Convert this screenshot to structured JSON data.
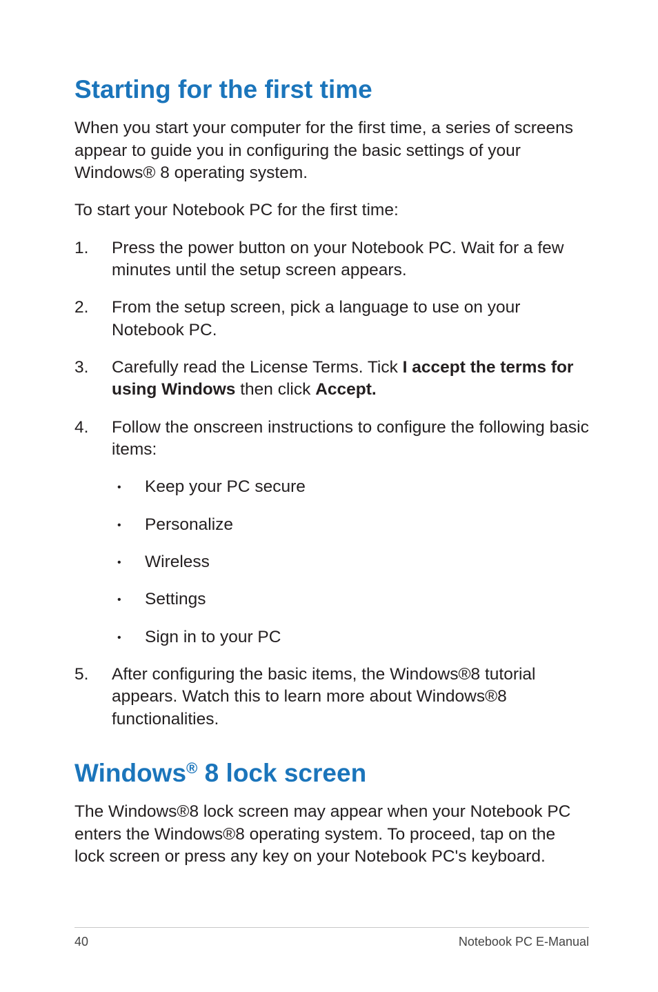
{
  "section1": {
    "heading": "Starting for the first time",
    "intro": "When you start your computer for the first time, a series of screens appear to guide you in configuring the basic settings of your Windows® 8 operating system.",
    "lead": "To start your Notebook PC for the first time:",
    "steps": [
      "Press the power button on your Notebook PC. Wait for a few minutes until the setup screen appears.",
      "From the setup screen, pick a language to use on your Notebook PC.",
      {
        "pre": "Carefully read the License Terms. Tick ",
        "bold1": "I accept the terms for using Windows",
        "mid": " then click ",
        "bold2": "Accept."
      },
      {
        "text": "Follow the onscreen instructions to configure the following basic items:",
        "bullets": [
          "Keep your PC secure",
          "Personalize",
          "Wireless",
          "Settings",
          "Sign in to your PC"
        ]
      },
      "After configuring the basic items, the Windows®8 tutorial appears. Watch this to learn more about Windows®8 functionalities."
    ]
  },
  "section2": {
    "heading_pre": "Windows",
    "heading_sup": "®",
    "heading_post": " 8 lock screen",
    "body": "The Windows®8 lock screen may appear when your Notebook PC enters the Windows®8 operating system. To proceed,  tap on the lock screen or press any key on your Notebook PC's keyboard."
  },
  "footer": {
    "page": "40",
    "doc": "Notebook PC E-Manual"
  }
}
